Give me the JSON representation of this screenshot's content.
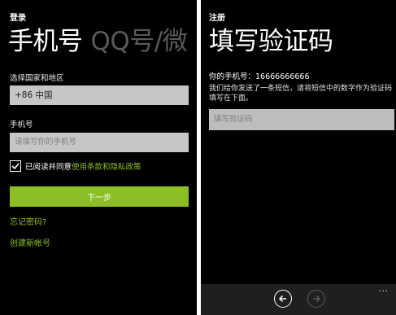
{
  "login": {
    "app_title": "登录",
    "pivot_active": "手机号",
    "pivot_inactive": "QQ号/微",
    "country_label": "选择国家和地区",
    "country_value": "+86 中国",
    "phone_label": "手机号",
    "phone_placeholder": "请填写你的手机号",
    "agree_text": "已阅读并同意",
    "agree_link": "使用条款和隐私政策",
    "agree_checked": true,
    "next_button": "下一步",
    "forgot_password": "忘记密码?",
    "create_account": "创建新帐号"
  },
  "register": {
    "app_title": "注册",
    "page_title": "填写验证码",
    "phone_line": "你的手机号：16666666666",
    "description": "我们给你发送了一条短信，请将短信中的数字作为验证码填写在下面。",
    "code_placeholder": "填写验证码",
    "app_bar": {
      "back_icon": "arrow-left-circle-icon",
      "next_icon": "arrow-right-circle-icon",
      "more": "..."
    }
  },
  "colors": {
    "accent": "#8cbf26",
    "field": "#c6c6c6",
    "background": "#000000"
  }
}
